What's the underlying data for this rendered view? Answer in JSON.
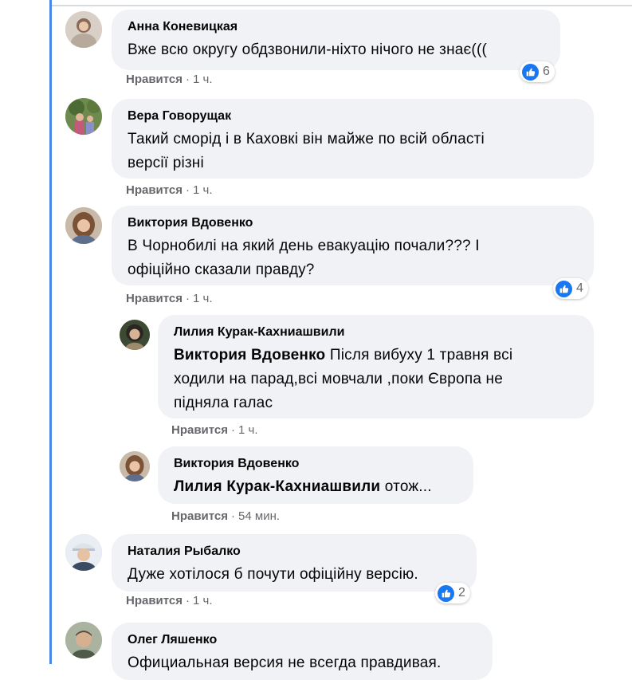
{
  "like_label": "Нравится",
  "colors": {
    "accent": "#1877f2",
    "bubble": "#f0f2f5",
    "meta": "#65676b",
    "rail": "#4a86e8"
  },
  "comments": [
    {
      "author": "Анна Коневицкая",
      "text": "Вже всю округу обдзвонили-ніхто нічого не знає(((",
      "time": "1 ч.",
      "reactions": "6"
    },
    {
      "author": "Вера Говорущак",
      "text_line1": "Такий сморід і в Каховкі він майже по всій області",
      "text_line2": "версії різні",
      "time": "1 ч."
    },
    {
      "author": "Виктория Вдовенко",
      "text_line1": "В Чорнобилі на який день евакуацію почали??? І",
      "text_line2": "офіційно сказали правду?",
      "time": "1 ч.",
      "reactions": "4"
    },
    {
      "author": "Лилия Курак-Кахниашвили",
      "mention": "Виктория Вдовенко",
      "text_line1": "Після вибуху 1 травня всі",
      "text_line2": "ходили на парад,всі мовчали ,поки Європа не",
      "text_line3": "підняла галас",
      "time": "1 ч."
    },
    {
      "author": "Виктория Вдовенко",
      "mention": "Лилия Курак-Кахниашвили",
      "text": "отож...",
      "time": "54 мин."
    },
    {
      "author": "Наталия Рыбалко",
      "text": "Дуже хотілося б почути офіційну версію.",
      "time": "1 ч.",
      "reactions": "2"
    },
    {
      "author": "Олег Ляшенко",
      "text": "Официальная версия не всегда правдивая."
    }
  ]
}
